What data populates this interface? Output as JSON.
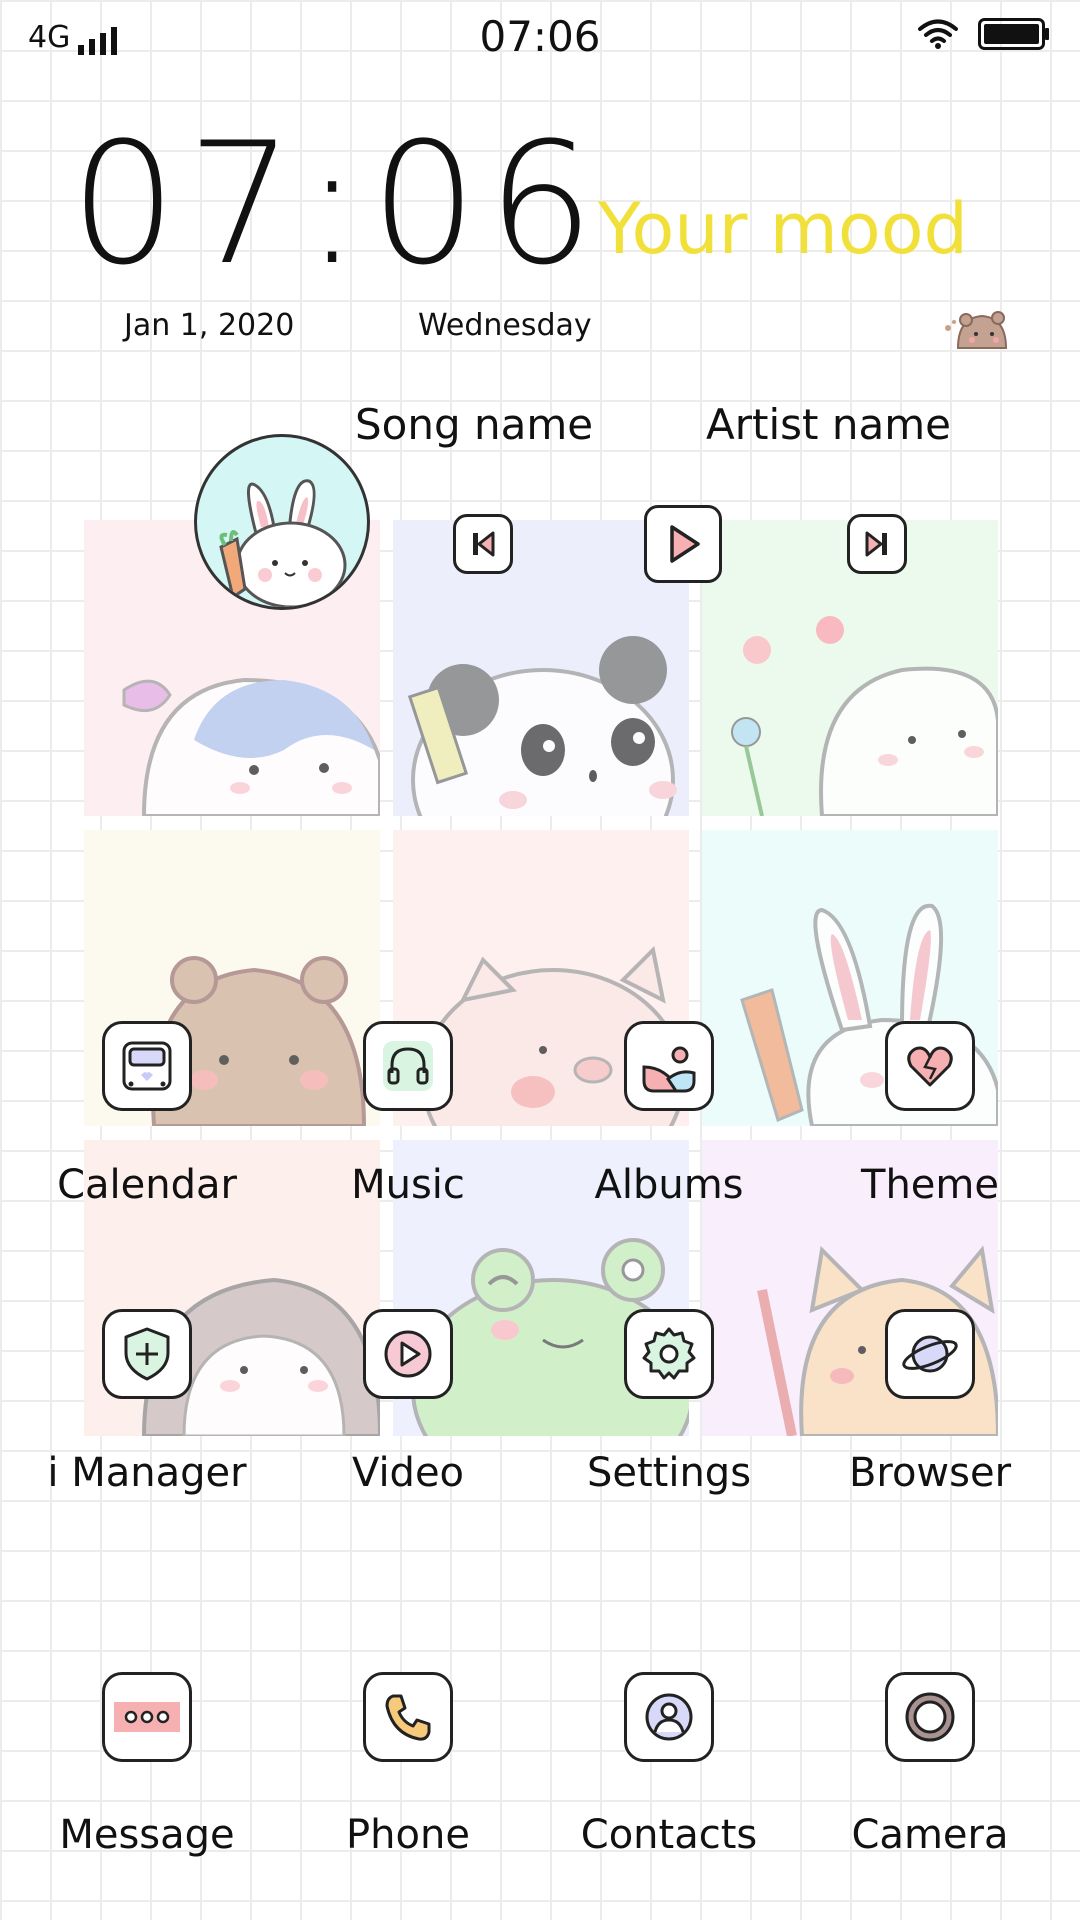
{
  "status_bar": {
    "network": "4G",
    "time": "07:06"
  },
  "clock": {
    "time": "07:06",
    "date": "Jan 1, 2020",
    "weekday": "Wednesday"
  },
  "mood": "Your mood",
  "music": {
    "song": "Song name",
    "artist": "Artist name"
  },
  "tiles": [
    {
      "color": "#fdeef2"
    },
    {
      "color": "#eceefb"
    },
    {
      "color": "#ecfaee"
    },
    {
      "color": "#fcfaee"
    },
    {
      "color": "#fdf0ee"
    },
    {
      "color": "#ecfcfb"
    },
    {
      "color": "#fdefec"
    },
    {
      "color": "#eef0fd"
    },
    {
      "color": "#f9eefc"
    }
  ],
  "apps": [
    {
      "label": "Calendar",
      "icon": "calendar-icon"
    },
    {
      "label": "Music",
      "icon": "headphones-icon"
    },
    {
      "label": "Albums",
      "icon": "image-icon"
    },
    {
      "label": "Theme",
      "icon": "heart-icon"
    },
    {
      "label": "i Manager",
      "icon": "shield-icon"
    },
    {
      "label": "Video",
      "icon": "play-icon"
    },
    {
      "label": "Settings",
      "icon": "gear-icon"
    },
    {
      "label": "Browser",
      "icon": "planet-icon"
    }
  ],
  "dock": [
    {
      "label": "Message",
      "icon": "message-icon"
    },
    {
      "label": "Phone",
      "icon": "phone-icon"
    },
    {
      "label": "Contacts",
      "icon": "contact-icon"
    },
    {
      "label": "Camera",
      "icon": "camera-icon"
    }
  ],
  "colors": {
    "mood": "#f2e03a",
    "accent_pink": "#f6b0b2",
    "accent_green": "#d9f4e0",
    "accent_lavender": "#d8d9f8"
  }
}
